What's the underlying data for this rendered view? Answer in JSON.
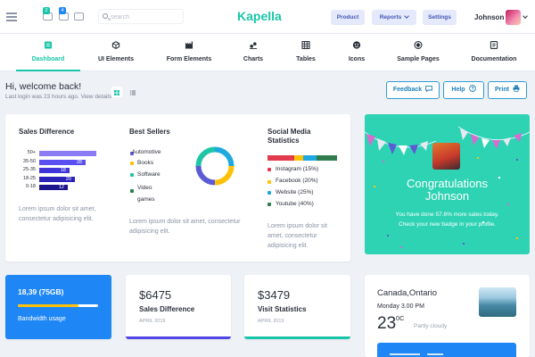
{
  "topbar": {
    "icons": [
      "menu-icon",
      "clipboard-icon",
      "inbox-icon",
      "chat-icon"
    ],
    "badges": [
      "2",
      "4"
    ],
    "search_placeholder": "search",
    "logo": "Kapella",
    "product_label": "Product",
    "reports_label": "Reports",
    "settings_label": "Settings",
    "username": "Johnson"
  },
  "nav": {
    "items": [
      {
        "label": "Dashboard",
        "icon": "dashboard-icon",
        "active": true
      },
      {
        "label": "UI Elements",
        "icon": "cube-icon"
      },
      {
        "label": "Form Elements",
        "icon": "factory-icon"
      },
      {
        "label": "Charts",
        "icon": "chart-icon"
      },
      {
        "label": "Tables",
        "icon": "table-icon"
      },
      {
        "label": "Icons",
        "icon": "smiley-icon"
      },
      {
        "label": "Sample Pages",
        "icon": "layers-icon"
      },
      {
        "label": "Documentation",
        "icon": "document-icon"
      }
    ]
  },
  "welcome": {
    "greeting": "Hi, welcome back!",
    "last_login": "Last login was 23 hours ago.",
    "view_details": "View details"
  },
  "actions": {
    "feedback": "Feedback",
    "help": "Help",
    "print": "Print"
  },
  "sales_difference": {
    "title": "Sales Difference",
    "rows": [
      {
        "label": "50+",
        "value": null
      },
      {
        "label": "35-50",
        "value": 28
      },
      {
        "label": "25-35",
        "value": 18
      },
      {
        "label": "18-25",
        "value": 20
      },
      {
        "label": "0-18",
        "value": 12
      }
    ],
    "text": "Lorem ipsum dolor sit amet, consectetur adipisicing elit.",
    "colors": [
      "#8b7cf6",
      "#5a4ff0",
      "#3f35d8",
      "#2b22b8",
      "#1b148c"
    ]
  },
  "best_sellers": {
    "title": "Best Sellers",
    "items": [
      {
        "label": "Automotive",
        "color": "#5b5bd6"
      },
      {
        "label": "Books",
        "color": "#ffc107"
      },
      {
        "label": "Software",
        "color": "#1fc6a6"
      },
      {
        "label": "Video games",
        "color": "#2f7d4f"
      }
    ],
    "text": "Lorem ipsum dolor sit amet, consectetur adipisicing elit."
  },
  "social": {
    "title": "Social Media Statistics",
    "items": [
      {
        "label": "Instagram (15%)",
        "color": "#e23b4d"
      },
      {
        "label": "Facebook (20%)",
        "color": "#ffc107"
      },
      {
        "label": "Website (25%)",
        "color": "#1fa9e1"
      },
      {
        "label": "Youtube (40%)",
        "color": "#2f7d4f"
      }
    ],
    "text": "Lorem ipsum dolor sit amet, consectetur adipisicing elit."
  },
  "congrats": {
    "title_line1": "Congratulations",
    "title_line2": "Johnson",
    "text": "You have done 57.6% more sales today. Check your new badge in your profile."
  },
  "bandwidth": {
    "value": "18,39 (75GB)",
    "label": "Bandwidth usage",
    "progress": 0.75
  },
  "sales_card": {
    "value": "$6475",
    "label": "Sales Difference",
    "date": "APRIL 2019",
    "accent": "#4f46e5"
  },
  "visits_card": {
    "value": "$3479",
    "label": "Visit Statistics",
    "date": "APRIL 2019",
    "accent": "#19c5a8"
  },
  "weather": {
    "city": "Canada,Ontario",
    "day": "Monday 3.00 PM",
    "temp": "23",
    "unit": "0C",
    "condition": "Partly cloudy"
  }
}
